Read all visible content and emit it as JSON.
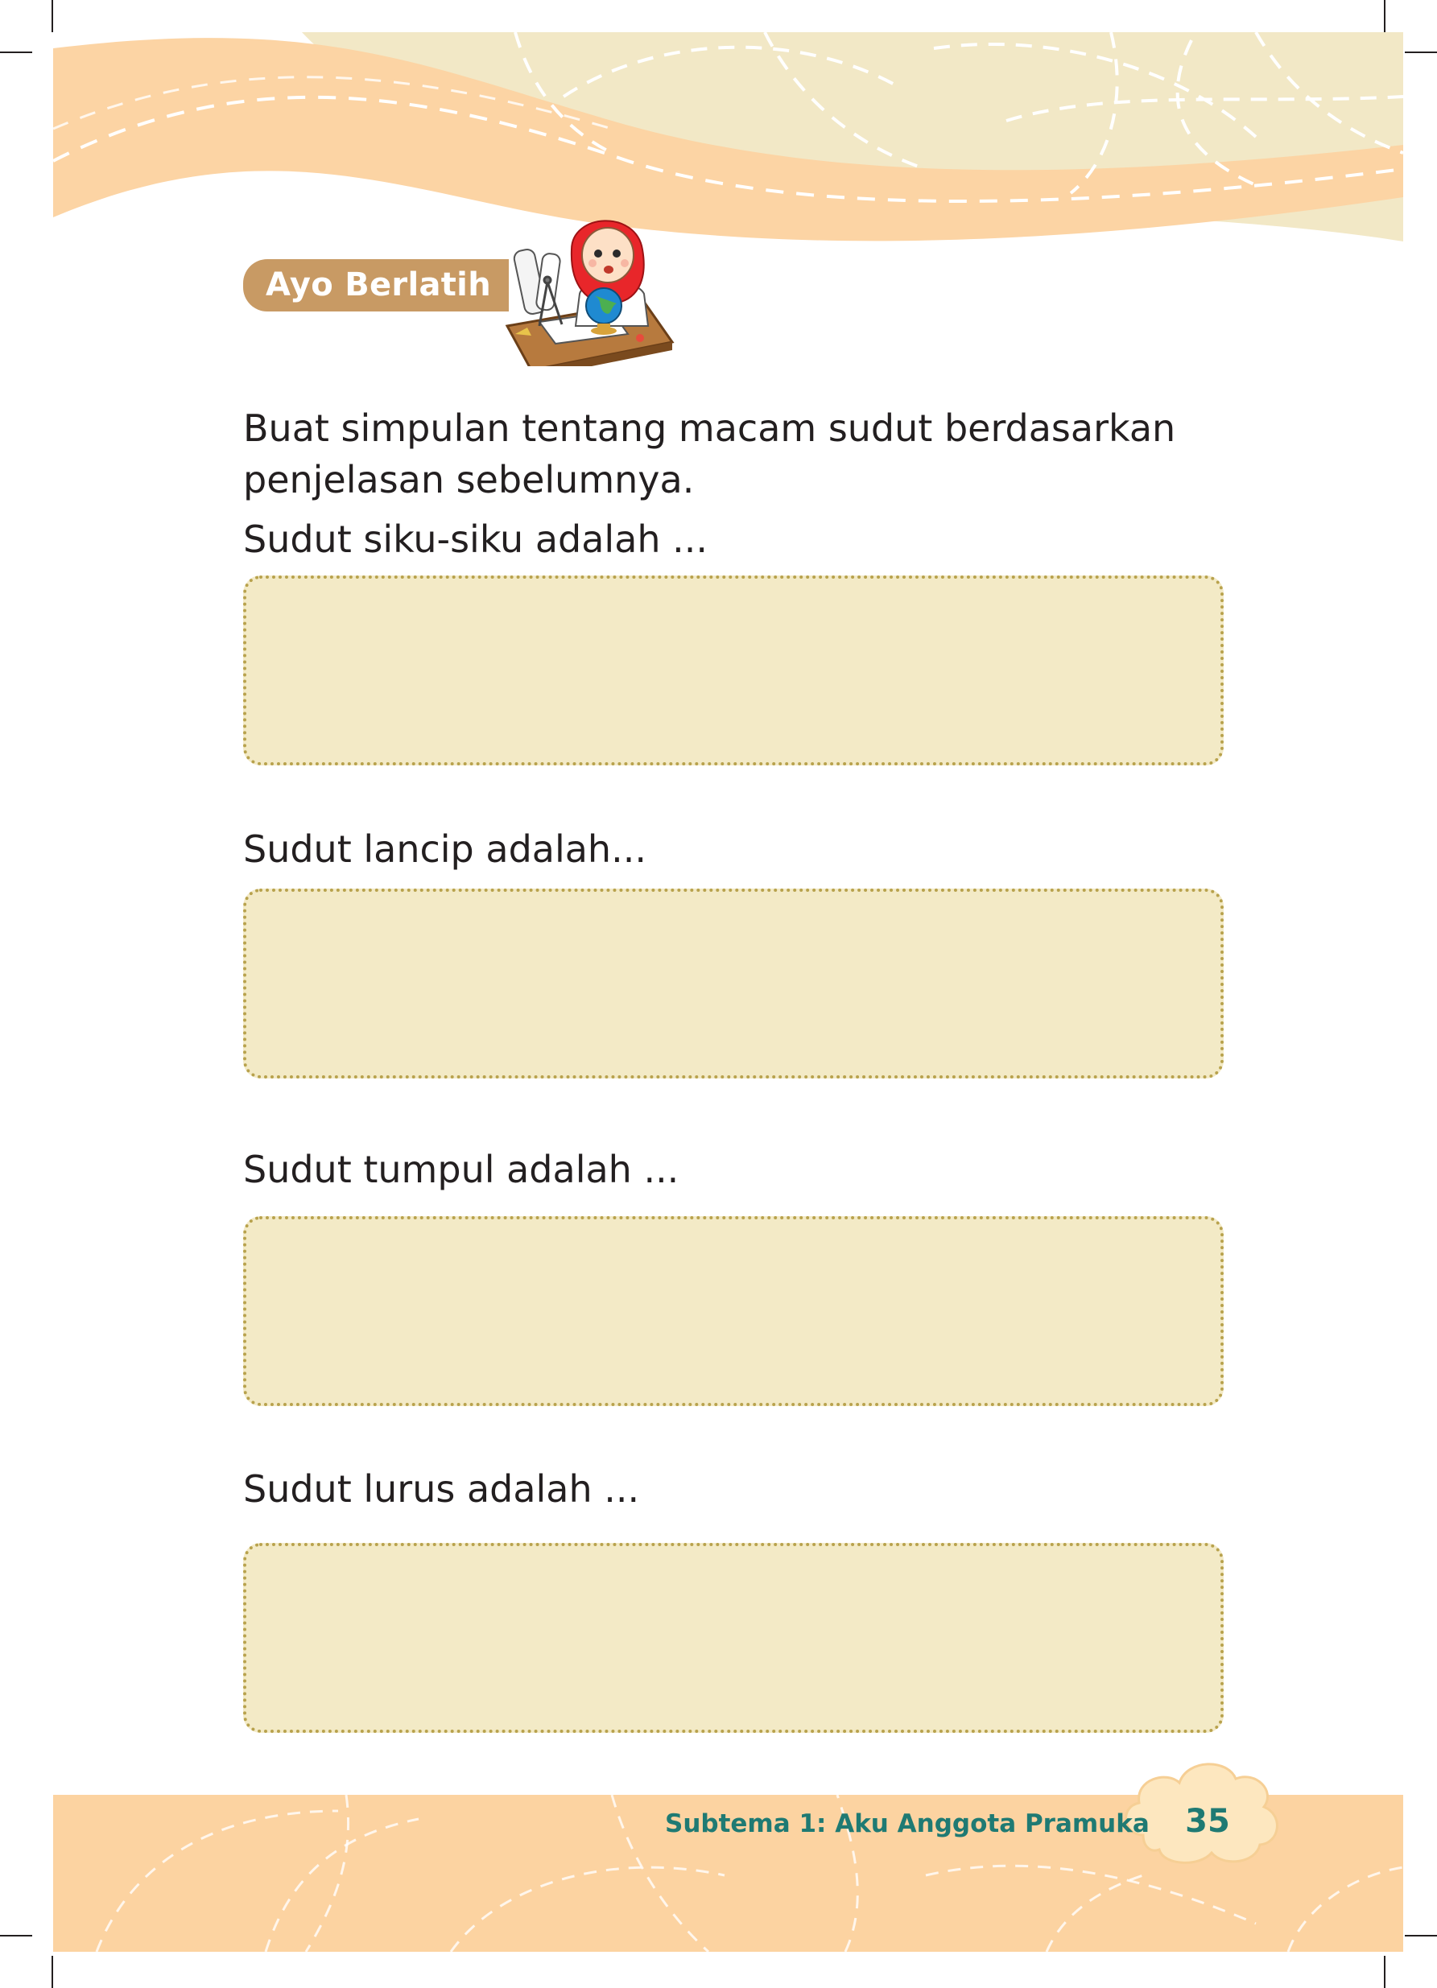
{
  "section": {
    "title": "Ayo Berlatih"
  },
  "intro": "Buat simpulan tentang macam sudut berdasarkan penjelasan sebelumnya.",
  "questions": [
    {
      "label": "Sudut siku-siku adalah ...",
      "answer": ""
    },
    {
      "label": "Sudut lancip adalah...",
      "answer": ""
    },
    {
      "label": "Sudut tumpul adalah ...",
      "answer": ""
    },
    {
      "label": "Sudut lurus adalah ...",
      "answer": ""
    }
  ],
  "footer": {
    "subtema": "Subtema 1: Aku Anggota Pramuka",
    "page_number": "35"
  },
  "colors": {
    "header_cream": "#f2e8c6",
    "header_peach": "#fcd4a4",
    "footer_peach": "#fcd3a1",
    "badge": "#c89a64",
    "answer_box": "#f3eac6",
    "answer_box_border": "#b8a24d",
    "footer_text": "#1f7a73"
  },
  "icons": [
    "girl-mascot-icon",
    "globe-icon",
    "compass-icon",
    "paper-roll-icon",
    "cloud-badge-icon"
  ]
}
